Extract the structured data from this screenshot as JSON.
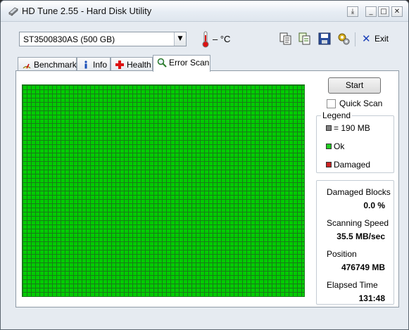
{
  "window": {
    "title": "HD Tune 2.55 - Hard Disk Utility",
    "controls": {
      "pin": "⤓",
      "minimize": "_",
      "maximize": "□",
      "close": "✕"
    }
  },
  "toolbar": {
    "drive": "ST3500830AS (500 GB)",
    "temperature": "– °C",
    "icons": [
      "copy-text-icon",
      "copy-info-icon",
      "save-icon",
      "options-icon"
    ],
    "exit_label": "Exit"
  },
  "tabs": [
    {
      "label": "Benchmark",
      "icon": "benchmark-icon"
    },
    {
      "label": "Info",
      "icon": "info-icon"
    },
    {
      "label": "Health",
      "icon": "health-icon"
    },
    {
      "label": "Error Scan",
      "icon": "magnifier-icon",
      "active": true
    }
  ],
  "error_scan": {
    "start_label": "Start",
    "quick_scan_label": "Quick Scan",
    "quick_scan_checked": false,
    "block_status": "ok",
    "legend": {
      "title": "Legend",
      "items": [
        {
          "label": "= 190 MB",
          "color": "#7f7f7f"
        },
        {
          "label": "Ok",
          "color": "#22cc22"
        },
        {
          "label": "Damaged",
          "color": "#cc2222"
        }
      ]
    },
    "stats": {
      "damaged_blocks_label": "Damaged Blocks",
      "damaged_blocks_value": "0.0 %",
      "scanning_speed_label": "Scanning Speed",
      "scanning_speed_value": "35.5 MB/sec",
      "position_label": "Position",
      "position_value": "476749 MB",
      "elapsed_label": "Elapsed Time",
      "elapsed_value": "131:48"
    }
  },
  "colors": {
    "ok_block": "#00cc00",
    "grid_line": "#1a7a1a",
    "accent": "#1a3fb8"
  }
}
